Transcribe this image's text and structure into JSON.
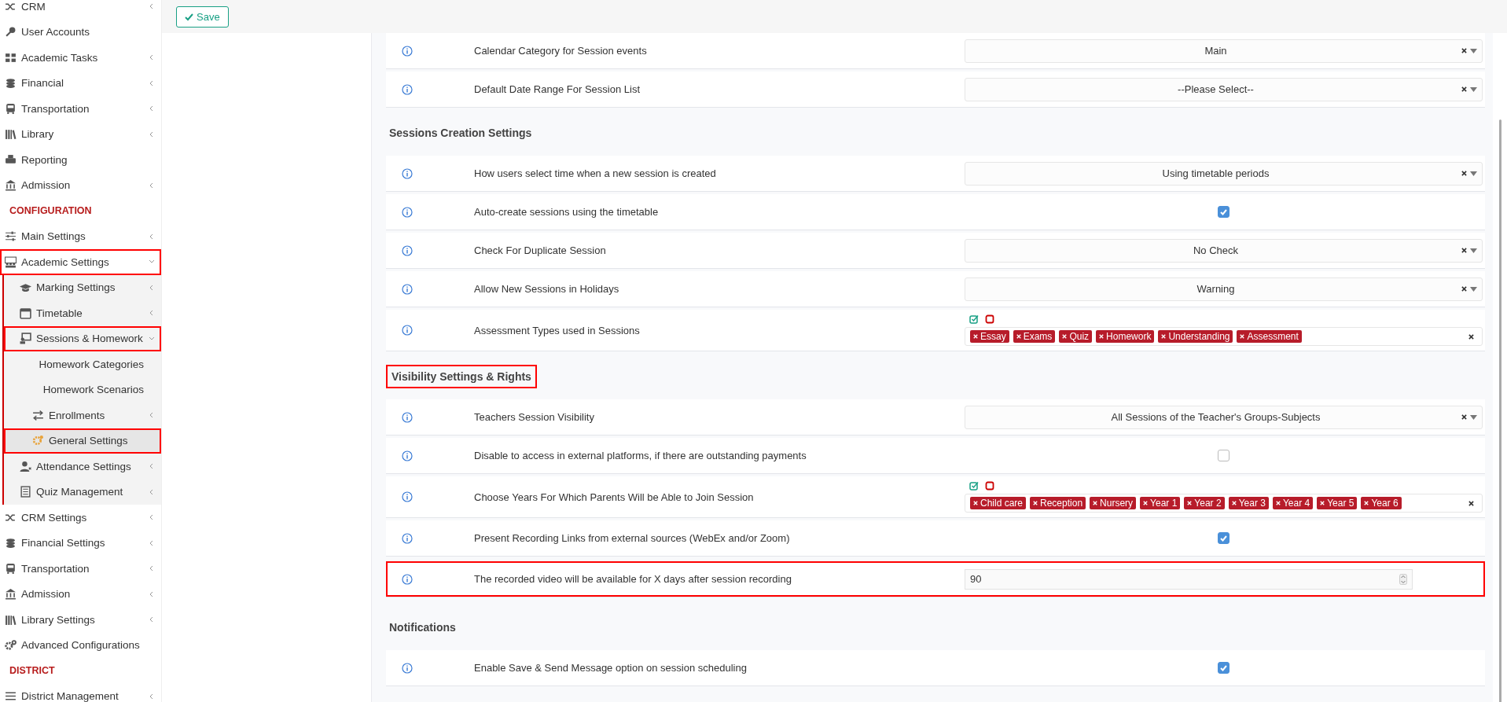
{
  "toolbar": {
    "save_button": "Save"
  },
  "sidebar": {
    "items": [
      {
        "kind": "item",
        "label": "CRM",
        "expandable": true,
        "expanded": false,
        "highlighted": false
      },
      {
        "kind": "item",
        "label": "User Accounts",
        "expandable": false,
        "highlighted": false
      },
      {
        "kind": "item",
        "label": "Academic Tasks",
        "expandable": true,
        "expanded": false,
        "highlighted": false
      },
      {
        "kind": "item",
        "label": "Financial",
        "expandable": true,
        "expanded": false,
        "highlighted": false
      },
      {
        "kind": "item",
        "label": "Transportation",
        "expandable": true,
        "expanded": false,
        "highlighted": false
      },
      {
        "kind": "item",
        "label": "Library",
        "expandable": true,
        "expanded": false,
        "highlighted": false
      },
      {
        "kind": "item",
        "label": "Reporting",
        "expandable": false,
        "highlighted": false
      },
      {
        "kind": "item",
        "label": "Admission",
        "expandable": true,
        "expanded": false,
        "highlighted": false
      },
      {
        "kind": "section",
        "label": "CONFIGURATION"
      },
      {
        "kind": "item",
        "label": "Main Settings",
        "expandable": true,
        "expanded": false,
        "highlighted": false
      },
      {
        "kind": "item",
        "label": "Academic Settings",
        "expandable": true,
        "expanded": true,
        "highlighted": true,
        "children": [
          {
            "kind": "item",
            "label": "Marking Settings",
            "expandable": true,
            "expanded": false,
            "highlighted": false
          },
          {
            "kind": "item",
            "label": "Timetable",
            "expandable": true,
            "expanded": false,
            "highlighted": false
          },
          {
            "kind": "item",
            "label": "Sessions & Homework",
            "expandable": true,
            "expanded": true,
            "highlighted": true,
            "children": [
              {
                "kind": "plain",
                "label": "Homework Categories",
                "expandable": false,
                "highlighted": false
              },
              {
                "kind": "plain",
                "label": "Homework Scenarios",
                "expandable": false,
                "highlighted": false
              },
              {
                "kind": "item",
                "label": "Enrollments",
                "expandable": true,
                "expanded": false,
                "highlighted": false
              },
              {
                "kind": "item",
                "label": "General Settings",
                "expandable": false,
                "highlighted": true,
                "selected": true
              }
            ]
          },
          {
            "kind": "item",
            "label": "Attendance Settings",
            "expandable": true,
            "expanded": false,
            "highlighted": false
          },
          {
            "kind": "item",
            "label": "Quiz Management",
            "expandable": true,
            "expanded": false,
            "highlighted": false
          }
        ]
      },
      {
        "kind": "item",
        "label": "CRM Settings",
        "expandable": true,
        "expanded": false,
        "highlighted": false
      },
      {
        "kind": "item",
        "label": "Financial Settings",
        "expandable": true,
        "expanded": false,
        "highlighted": false
      },
      {
        "kind": "item",
        "label": "Transportation",
        "expandable": true,
        "expanded": false,
        "highlighted": false
      },
      {
        "kind": "item",
        "label": "Admission",
        "expandable": true,
        "expanded": false,
        "highlighted": false
      },
      {
        "kind": "item",
        "label": "Library Settings",
        "expandable": true,
        "expanded": false,
        "highlighted": false
      },
      {
        "kind": "item",
        "label": "Advanced Configurations",
        "expandable": false,
        "highlighted": false
      },
      {
        "kind": "section",
        "label": "DISTRICT"
      },
      {
        "kind": "item",
        "label": "District Management",
        "expandable": true,
        "expanded": false,
        "highlighted": false
      }
    ]
  },
  "groups": [
    {
      "rows": [
        {
          "label": "Calendar Category for Session events",
          "kind": "select",
          "value": "Main",
          "highlighted": false
        },
        {
          "label": "Default Date Range For Session List",
          "kind": "select",
          "value": "--Please Select--",
          "highlighted": false
        }
      ]
    },
    {
      "heading": "Sessions Creation Settings",
      "heading_highlighted": false,
      "rows": [
        {
          "label": "How users select time when a new session is created",
          "kind": "select",
          "value": "Using timetable periods",
          "highlighted": false
        },
        {
          "label": "Auto-create sessions using the timetable",
          "kind": "checkbox",
          "checked": true,
          "highlighted": false
        },
        {
          "label": "Check For Duplicate Session",
          "kind": "select",
          "value": "No Check",
          "highlighted": false
        },
        {
          "label": "Allow New Sessions in Holidays",
          "kind": "select",
          "value": "Warning",
          "highlighted": false
        },
        {
          "label": "Assessment Types used in Sessions",
          "kind": "tags",
          "tags": [
            "Essay",
            "Exams",
            "Quiz",
            "Homework",
            "Understanding",
            "Assessment"
          ],
          "highlighted": false
        }
      ]
    },
    {
      "heading": "Visibility Settings & Rights",
      "heading_highlighted": true,
      "rows": [
        {
          "label": "Teachers Session Visibility",
          "kind": "select",
          "value": "All Sessions of the Teacher's Groups-Subjects",
          "highlighted": false
        },
        {
          "label": "Disable to access in external platforms, if there are outstanding payments",
          "kind": "checkbox",
          "checked": false,
          "highlighted": false
        },
        {
          "label": "Choose Years For Which Parents Will be Able to Join Session",
          "kind": "tags",
          "tags": [
            "Child care",
            "Reception",
            "Nursery",
            "Year 1",
            "Year 2",
            "Year 3",
            "Year 4",
            "Year 5",
            "Year 6"
          ],
          "highlighted": false
        },
        {
          "label": "Present Recording Links from external sources (WebEx and/or Zoom)",
          "kind": "checkbox",
          "checked": true,
          "highlighted": false
        },
        {
          "label": "The recorded video will be available for X days after session recording",
          "kind": "number",
          "value": "90",
          "highlighted": true
        }
      ]
    },
    {
      "heading": "Notifications",
      "heading_highlighted": false,
      "rows": [
        {
          "label": "Enable Save & Send Message option on session scheduling",
          "kind": "checkbox",
          "checked": true,
          "highlighted": false
        }
      ]
    }
  ]
}
